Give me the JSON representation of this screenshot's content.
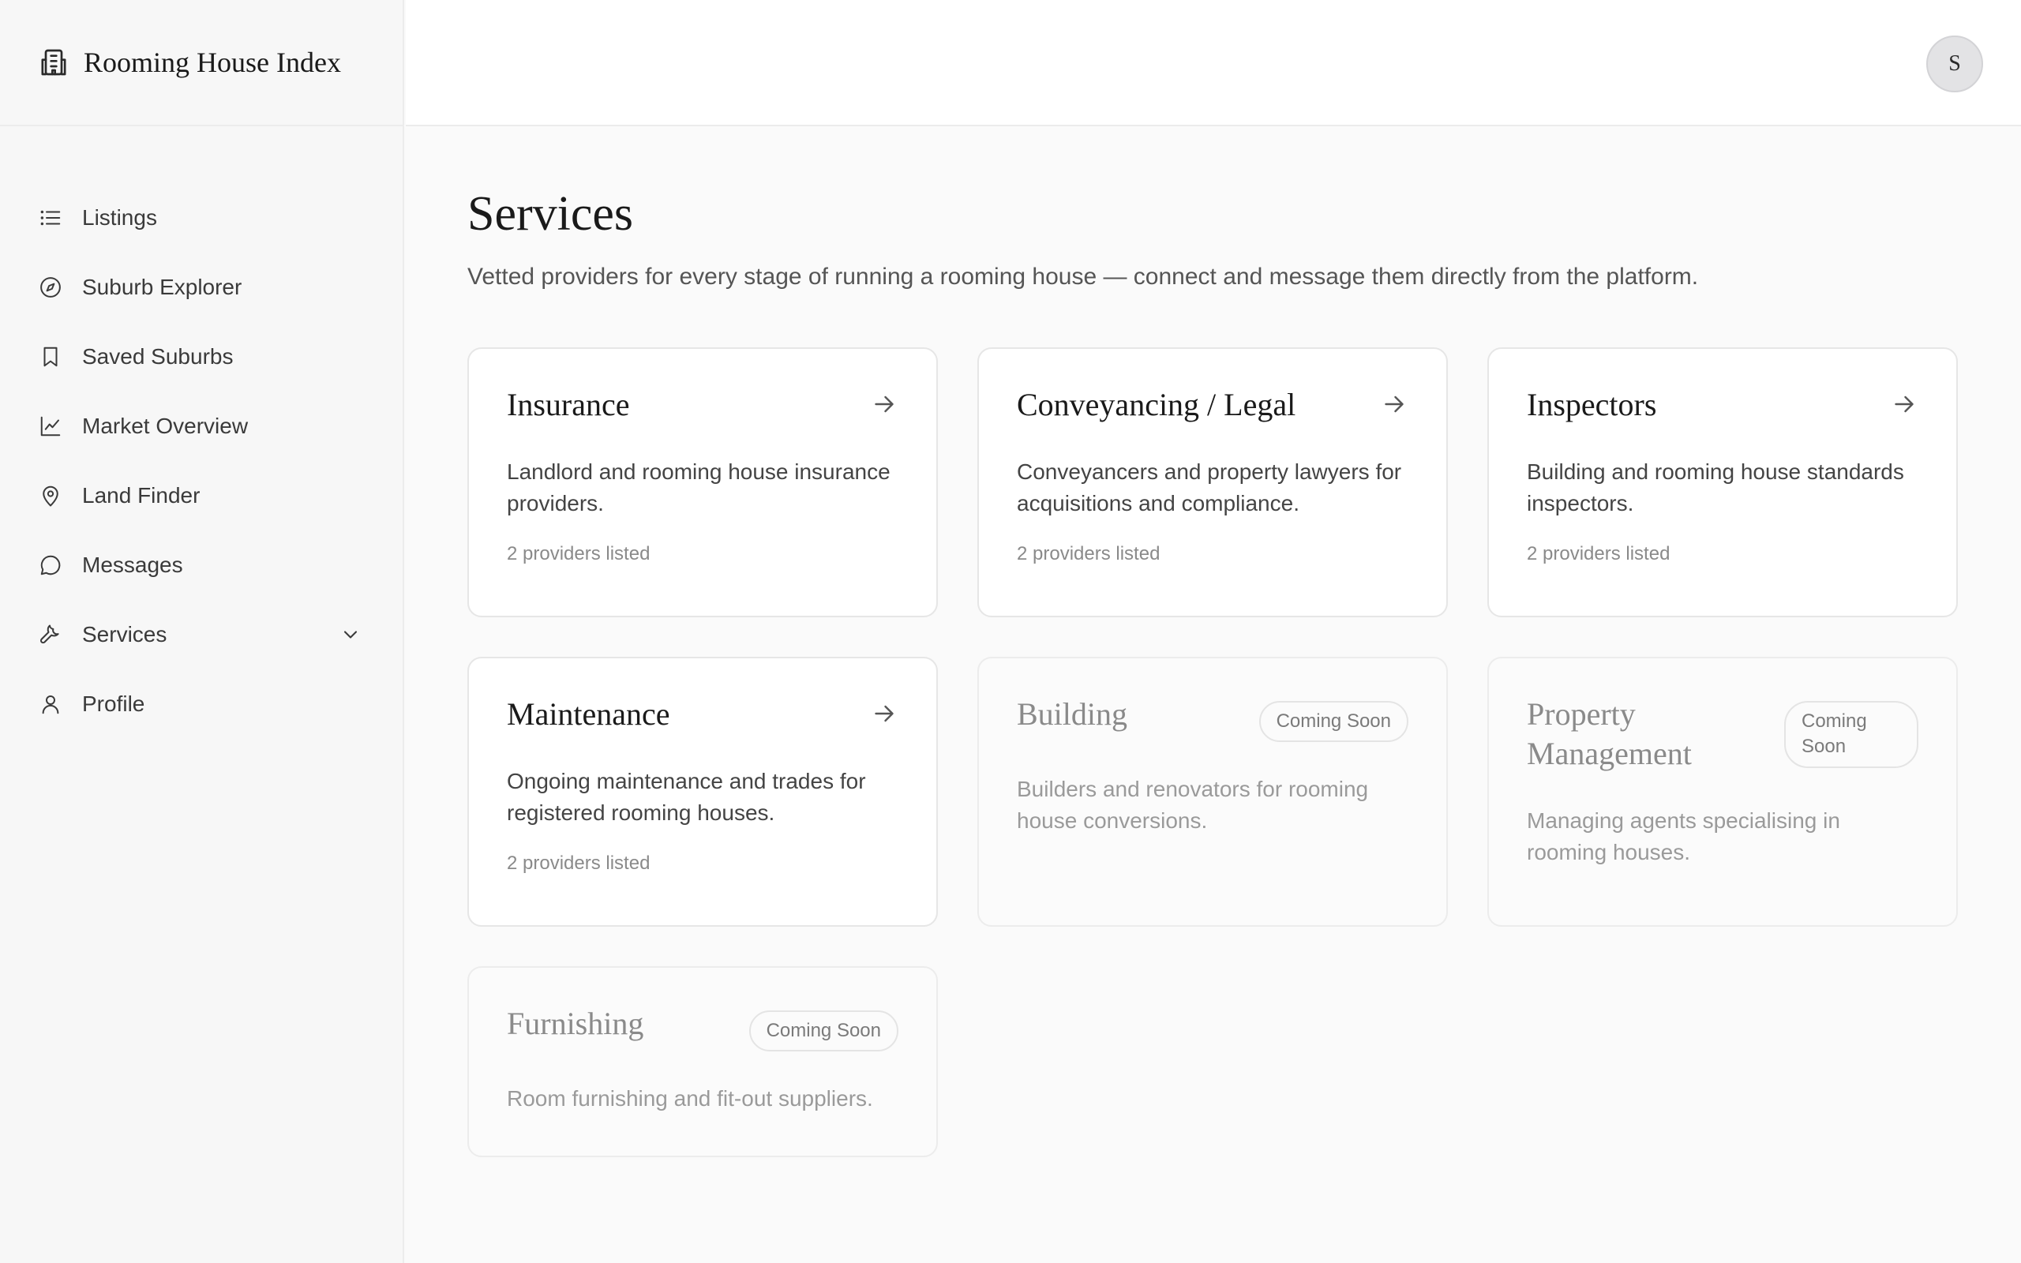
{
  "app": {
    "name": "Rooming House Index",
    "logo_icon": "building-icon"
  },
  "user": {
    "avatar_initial": "S"
  },
  "sidebar": {
    "items": [
      {
        "label": "Listings",
        "icon": "list-icon"
      },
      {
        "label": "Suburb Explorer",
        "icon": "compass-icon"
      },
      {
        "label": "Saved Suburbs",
        "icon": "bookmark-icon"
      },
      {
        "label": "Market Overview",
        "icon": "line-chart-icon"
      },
      {
        "label": "Land Finder",
        "icon": "map-pin-icon"
      },
      {
        "label": "Messages",
        "icon": "message-icon"
      },
      {
        "label": "Services",
        "icon": "wrench-icon",
        "expanded": true
      },
      {
        "label": "Profile",
        "icon": "user-icon"
      }
    ]
  },
  "page": {
    "title": "Services",
    "subtitle": "Vetted providers for every stage of running a rooming house — connect and message them directly from the platform."
  },
  "services": [
    {
      "title": "Insurance",
      "description": "Landlord and rooming house insurance providers.",
      "meta": "2 providers listed",
      "status": "available"
    },
    {
      "title": "Conveyancing / Legal",
      "description": "Conveyancers and property lawyers for acquisitions and compliance.",
      "meta": "2 providers listed",
      "status": "available"
    },
    {
      "title": "Inspectors",
      "description": "Building and rooming house standards inspectors.",
      "meta": "2 providers listed",
      "status": "available"
    },
    {
      "title": "Maintenance",
      "description": "Ongoing maintenance and trades for registered rooming houses.",
      "meta": "2 providers listed",
      "status": "available"
    },
    {
      "title": "Building",
      "description": "Builders and renovators for rooming house conversions.",
      "badge": "Coming Soon",
      "status": "coming-soon"
    },
    {
      "title": "Property Management",
      "description": "Managing agents specialising in rooming houses.",
      "badge": "Coming Soon",
      "status": "coming-soon"
    },
    {
      "title": "Furnishing",
      "description": "Room furnishing and fit-out suppliers.",
      "badge": "Coming Soon",
      "status": "coming-soon"
    }
  ],
  "colors": {
    "accent": "#1a1a1a",
    "muted": "#8a8a8a",
    "border": "#e6e6e6",
    "background": "#fafafa"
  }
}
